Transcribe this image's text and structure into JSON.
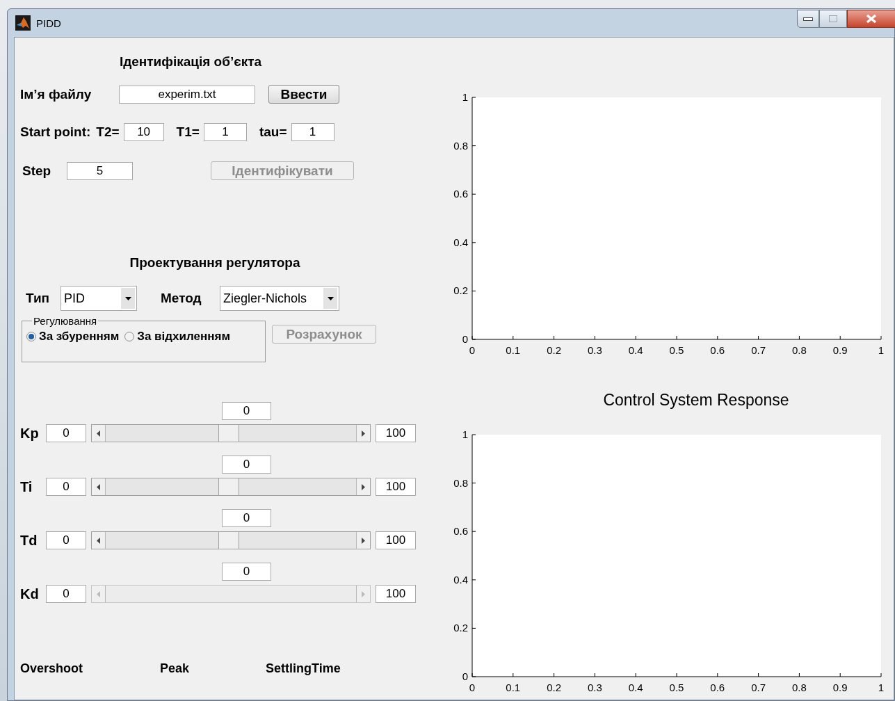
{
  "window": {
    "title": "PIDD"
  },
  "identification": {
    "title": "Ідентифікація об’єкта",
    "file_label": "Ім’я файлу",
    "file_value": "experim.txt",
    "load_button": {
      "label": "Ввести",
      "disabled": false
    },
    "start_label": "Start point:",
    "params": [
      {
        "label": "T2=",
        "value": "10"
      },
      {
        "label": "T1=",
        "value": "1"
      },
      {
        "label": "tau=",
        "value": "1"
      }
    ],
    "step_label": "Step",
    "step_value": "5",
    "identify_button": {
      "label": "Ідентифікувати",
      "disabled": true
    }
  },
  "design": {
    "title": "Проектування регулятора",
    "type_label": "Тип",
    "type_value": "PID",
    "method_label": "Метод",
    "method_value": "Ziegler-Nichols",
    "group": {
      "title": "Регулювання",
      "options": [
        {
          "label": "За збуренням",
          "selected": true
        },
        {
          "label": "За відхиленням",
          "selected": false
        }
      ]
    },
    "compute_button": {
      "label": "Розрахунок",
      "disabled": true
    }
  },
  "gains": [
    {
      "label": "Kp",
      "current": "0",
      "min": "0",
      "max": "100",
      "level": 0.49,
      "disabled": false
    },
    {
      "label": "Ti",
      "current": "0",
      "min": "0",
      "max": "100",
      "level": 0.49,
      "disabled": false
    },
    {
      "label": "Td",
      "current": "0",
      "min": "0",
      "max": "100",
      "level": 0.49,
      "disabled": false
    },
    {
      "label": "Kd",
      "current": "0",
      "min": "0",
      "max": "100",
      "disabled": true
    }
  ],
  "results": [
    "Overshoot",
    "Peak",
    "SettlingTime"
  ],
  "plots": [
    {
      "chart_data": {
        "type": "line",
        "xlim": [
          0,
          1
        ],
        "ylim": [
          0,
          1
        ],
        "xticks": [
          0,
          0.1,
          0.2,
          0.3,
          0.4,
          0.5,
          0.6,
          0.7,
          0.8,
          0.9,
          1
        ],
        "yticks": [
          0,
          0.2,
          0.4,
          0.6,
          0.8,
          1
        ]
      }
    },
    {
      "chart_data": {
        "type": "line",
        "title": "Control System Response",
        "xlim": [
          0,
          1
        ],
        "ylim": [
          0,
          1
        ],
        "xticks": [
          0,
          0.1,
          0.2,
          0.3,
          0.4,
          0.5,
          0.6,
          0.7,
          0.8,
          0.9,
          1
        ],
        "yticks": [
          0,
          0.2,
          0.4,
          0.6,
          0.8,
          1
        ]
      }
    }
  ]
}
